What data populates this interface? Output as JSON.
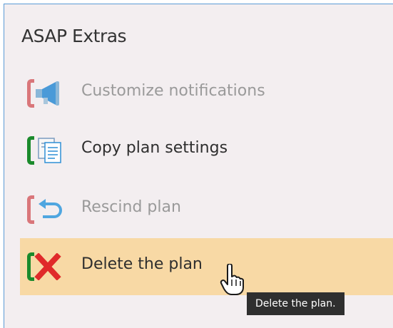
{
  "panel": {
    "title": "ASAP Extras"
  },
  "menu": {
    "items": [
      {
        "label": "Customize notifications",
        "icon": "megaphone-icon",
        "state": "disabled"
      },
      {
        "label": "Copy plan settings",
        "icon": "copy-icon",
        "state": "enabled"
      },
      {
        "label": "Rescind plan",
        "icon": "undo-arrow-icon",
        "state": "disabled"
      },
      {
        "label": "Delete the plan",
        "icon": "delete-x-icon",
        "state": "enabled-hovered"
      }
    ]
  },
  "tooltip": {
    "text": "Delete the plan."
  },
  "colors": {
    "panel_bg": "#f3eef0",
    "hover_bg": "#f8d9a5",
    "bracket_red": "#d9767a",
    "bracket_green": "#1b8a2c",
    "delete_red": "#e02a2a",
    "icon_blue": "#2e8fd6",
    "disabled_text": "#9a9a9a",
    "enabled_text": "#2e2e2e"
  }
}
